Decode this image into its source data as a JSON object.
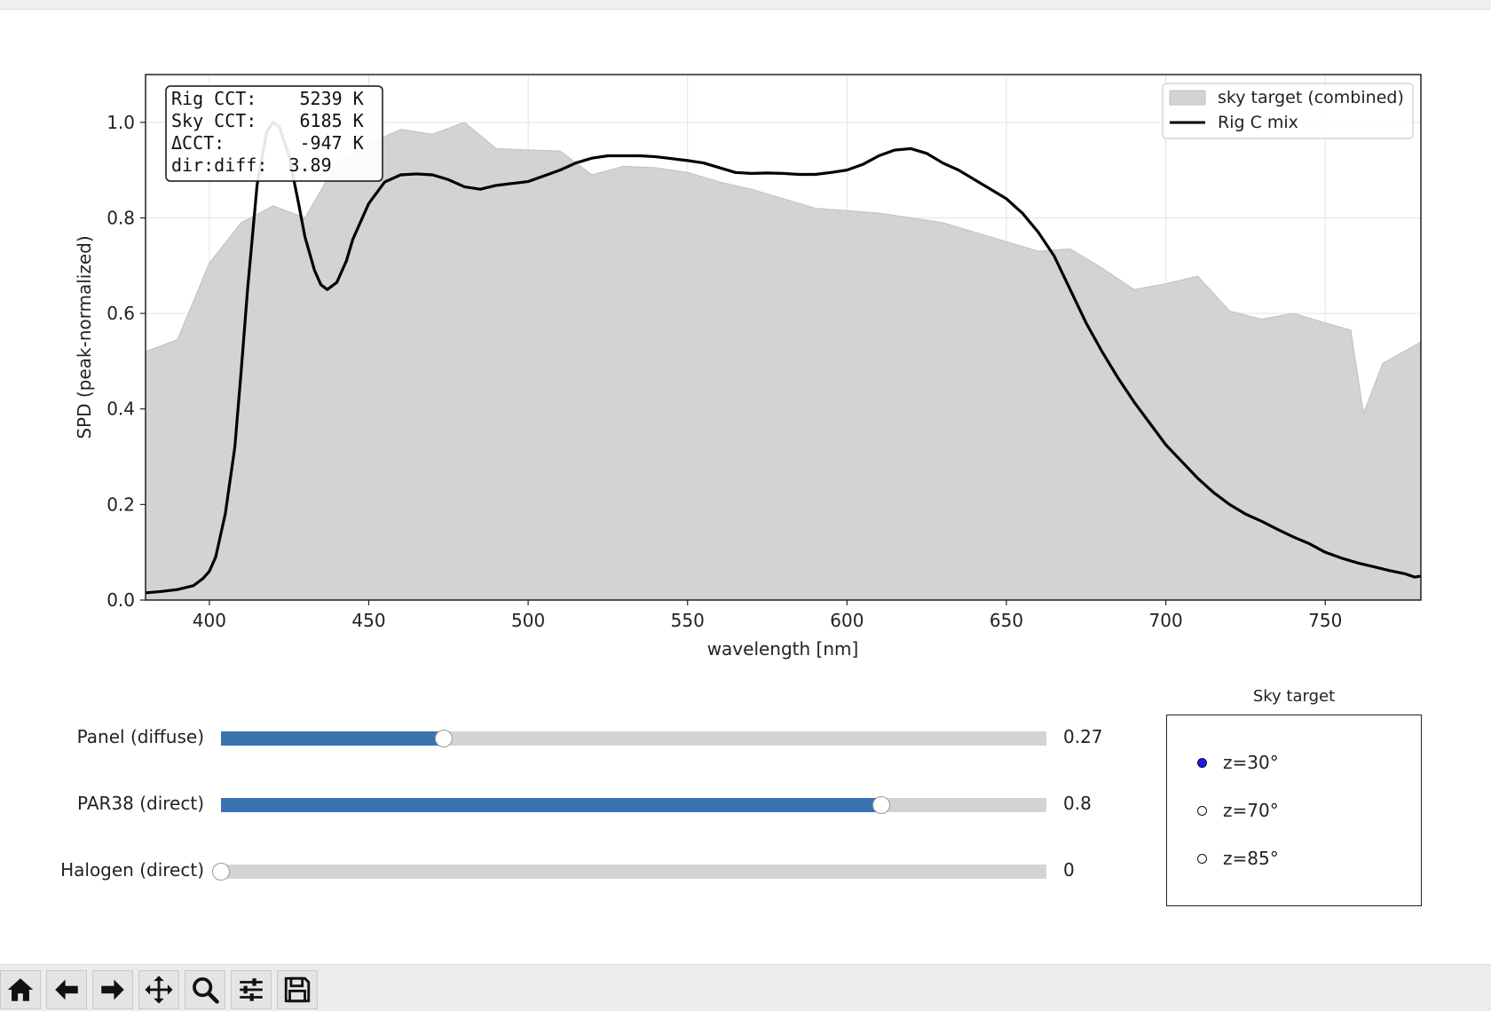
{
  "chart_data": {
    "type": "area",
    "xlabel": "wavelength [nm]",
    "ylabel": "SPD (peak-normalized)",
    "xlim": [
      380,
      780
    ],
    "ylim": [
      0,
      1.1
    ],
    "xticks": [
      400,
      450,
      500,
      550,
      600,
      650,
      700,
      750
    ],
    "yticks": [
      0.0,
      0.2,
      0.4,
      0.6,
      0.8,
      1.0
    ],
    "ytick_labels": [
      "0.0",
      "0.2",
      "0.4",
      "0.6",
      "0.8",
      "1.0"
    ],
    "grid": true,
    "legend_position": "top-right",
    "series": [
      {
        "name": "sky target (combined)",
        "type": "area",
        "color": "#d3d3d3",
        "x": [
          380,
          390,
          400,
          410,
          420,
          430,
          440,
          450,
          460,
          470,
          480,
          490,
          500,
          510,
          520,
          530,
          540,
          550,
          560,
          570,
          580,
          590,
          600,
          610,
          620,
          630,
          640,
          650,
          660,
          670,
          680,
          690,
          700,
          710,
          720,
          730,
          740,
          750,
          758,
          762,
          768,
          780
        ],
        "y": [
          0.52,
          0.545,
          0.705,
          0.79,
          0.825,
          0.8,
          0.915,
          0.955,
          0.985,
          0.975,
          1.0,
          0.945,
          0.942,
          0.94,
          0.89,
          0.908,
          0.905,
          0.895,
          0.875,
          0.86,
          0.84,
          0.82,
          0.815,
          0.81,
          0.8,
          0.79,
          0.77,
          0.75,
          0.73,
          0.735,
          0.695,
          0.65,
          0.662,
          0.678,
          0.605,
          0.588,
          0.6,
          0.58,
          0.565,
          0.39,
          0.495,
          0.54
        ]
      },
      {
        "name": "Rig C mix",
        "type": "line",
        "color": "#000000",
        "x": [
          380,
          385,
          390,
          395,
          398,
          400,
          402,
          405,
          408,
          410,
          412,
          415,
          418,
          420,
          422,
          425,
          428,
          430,
          433,
          435,
          437,
          440,
          443,
          445,
          448,
          450,
          455,
          460,
          465,
          470,
          475,
          480,
          485,
          490,
          495,
          500,
          505,
          510,
          515,
          520,
          525,
          530,
          535,
          540,
          545,
          550,
          555,
          560,
          565,
          570,
          575,
          580,
          585,
          590,
          595,
          600,
          605,
          610,
          615,
          620,
          625,
          630,
          635,
          640,
          645,
          650,
          655,
          660,
          665,
          670,
          675,
          680,
          685,
          690,
          695,
          700,
          705,
          710,
          715,
          720,
          725,
          730,
          735,
          740,
          745,
          750,
          755,
          760,
          765,
          770,
          775,
          778,
          780
        ],
        "y": [
          0.015,
          0.018,
          0.022,
          0.03,
          0.045,
          0.06,
          0.09,
          0.18,
          0.32,
          0.48,
          0.65,
          0.87,
          0.98,
          1.0,
          0.99,
          0.93,
          0.83,
          0.76,
          0.69,
          0.66,
          0.65,
          0.665,
          0.71,
          0.755,
          0.8,
          0.83,
          0.875,
          0.89,
          0.892,
          0.89,
          0.88,
          0.865,
          0.86,
          0.868,
          0.872,
          0.876,
          0.888,
          0.9,
          0.915,
          0.925,
          0.93,
          0.93,
          0.93,
          0.928,
          0.924,
          0.92,
          0.915,
          0.905,
          0.895,
          0.893,
          0.894,
          0.893,
          0.891,
          0.891,
          0.895,
          0.9,
          0.912,
          0.93,
          0.942,
          0.945,
          0.935,
          0.915,
          0.9,
          0.88,
          0.86,
          0.84,
          0.81,
          0.77,
          0.72,
          0.65,
          0.58,
          0.52,
          0.465,
          0.415,
          0.37,
          0.325,
          0.29,
          0.255,
          0.225,
          0.2,
          0.18,
          0.165,
          0.148,
          0.132,
          0.118,
          0.1,
          0.088,
          0.078,
          0.07,
          0.062,
          0.055,
          0.048,
          0.05
        ]
      }
    ],
    "annotation": {
      "lines": [
        "Rig CCT:    5239 K",
        "Sky CCT:    6185 K",
        "ΔCCT:       -947 K",
        "dir:diff:  3.89"
      ]
    }
  },
  "sliders": [
    {
      "label": "Panel (diffuse)",
      "value": 0.27,
      "value_text": "0.27",
      "fraction": 0.27
    },
    {
      "label": "PAR38 (direct)",
      "value": 0.8,
      "value_text": "0.8",
      "fraction": 0.8
    },
    {
      "label": "Halogen (direct)",
      "value": 0,
      "value_text": "0",
      "fraction": 0.0
    }
  ],
  "radio": {
    "title": "Sky target",
    "options": [
      "z=30°",
      "z=70°",
      "z=85°"
    ],
    "selected_index": 0,
    "selected_color": "#1a1aff"
  },
  "toolbar": {
    "buttons": [
      "home-icon",
      "back-arrow-icon",
      "forward-arrow-icon",
      "pan-icon",
      "zoom-icon",
      "configure-subplots-icon",
      "save-icon"
    ]
  },
  "colors": {
    "slider_fill": "#3a73b0",
    "slider_track": "#d3d3d3"
  }
}
